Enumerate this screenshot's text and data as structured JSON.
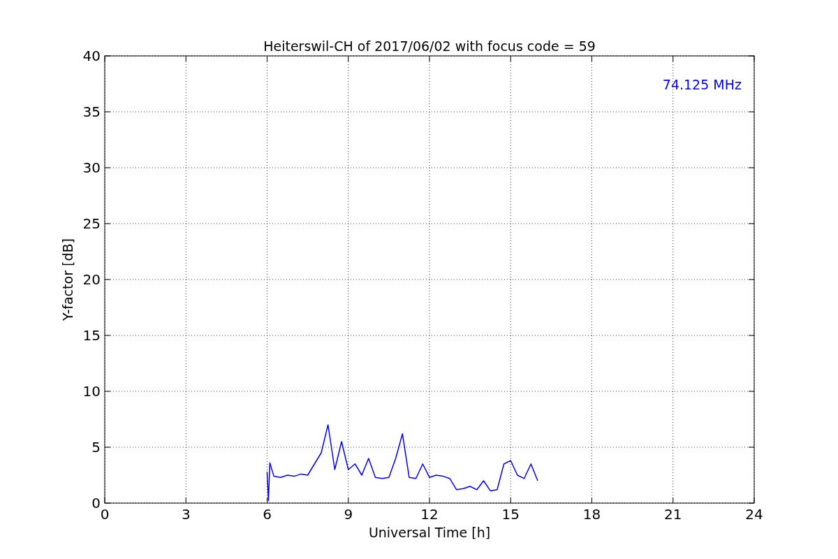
{
  "chart": {
    "chart_data": {
      "type": "line",
      "title": "Heiterswil-CH of 2017/06/02 with focus code = 59",
      "xlabel": "Universal Time [h]",
      "ylabel": "Y-factor [dB]",
      "x": [
        6,
        6.05,
        6.1,
        6.25,
        6.5,
        6.75,
        7,
        7.25,
        7.5,
        7.75,
        8,
        8.25,
        8.5,
        8.75,
        9,
        9.25,
        9.5,
        9.75,
        10,
        10.25,
        10.5,
        10.75,
        11,
        11.25,
        11.5,
        11.75,
        12,
        12.25,
        12.5,
        12.75,
        13,
        13.25,
        13.5,
        13.75,
        14,
        14.25,
        14.5,
        14.75,
        15,
        15.25,
        15.5,
        15.75,
        16
      ],
      "series": [
        {
          "name": "74.125 MHz",
          "color": "#0000ff",
          "values": [
            2.8,
            0.2,
            3.6,
            2.4,
            2.3,
            2.5,
            2.4,
            2.6,
            2.5,
            3.5,
            4.5,
            7.0,
            3.0,
            5.5,
            3.0,
            3.5,
            2.5,
            4.0,
            2.3,
            2.2,
            2.3,
            4.0,
            6.2,
            2.3,
            2.2,
            3.5,
            2.3,
            2.5,
            2.4,
            2.2,
            1.2,
            1.3,
            1.5,
            1.2,
            2.0,
            1.1,
            1.2,
            3.5,
            3.8,
            2.5,
            2.2,
            3.5,
            2.0
          ]
        }
      ],
      "xlim": [
        0,
        24
      ],
      "ylim": [
        0,
        40
      ],
      "xticks": [
        0,
        3,
        6,
        9,
        12,
        15,
        18,
        21,
        24
      ],
      "yticks": [
        0,
        5,
        10,
        15,
        20,
        25,
        30,
        35,
        40
      ],
      "grid": true
    }
  }
}
